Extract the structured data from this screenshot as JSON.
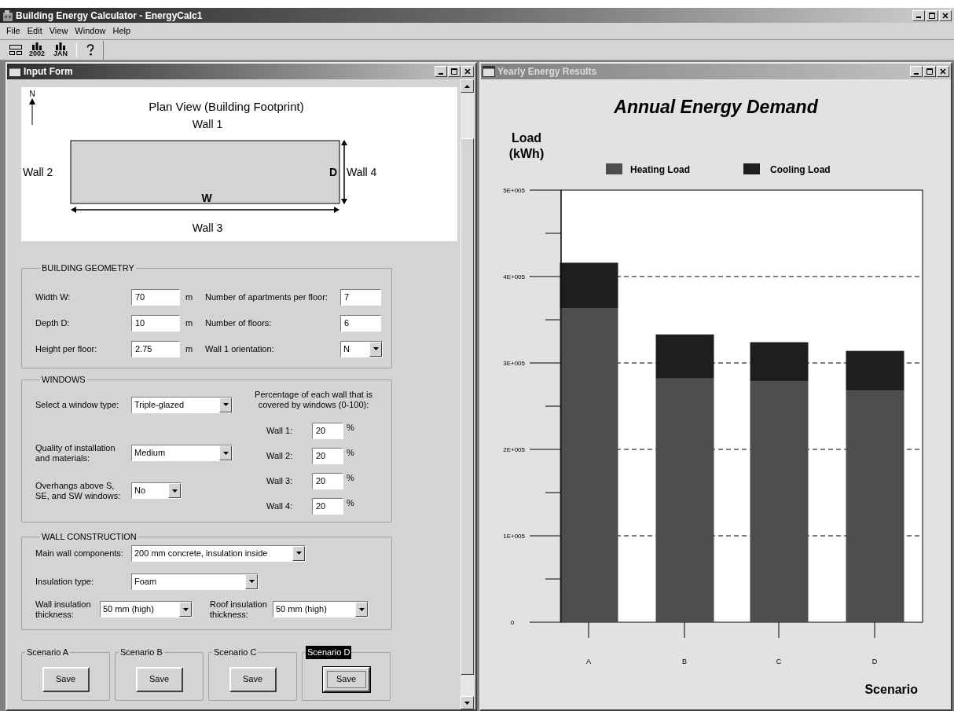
{
  "app": {
    "title": "Building Energy Calculator - EnergyCalc1"
  },
  "menu": [
    "File",
    "Edit",
    "View",
    "Window",
    "Help"
  ],
  "toolbar": {
    "year": "2002",
    "month": "JAN"
  },
  "input_form": {
    "title": "Input Form",
    "active": true,
    "plan_view": {
      "title": "Plan View (Building Footprint)",
      "north": "N",
      "walls": [
        "Wall 1",
        "Wall 2",
        "Wall 3",
        "Wall 4"
      ],
      "width_label": "W",
      "depth_label": "D"
    },
    "geometry": {
      "heading": "BUILDING GEOMETRY",
      "fields": [
        {
          "label": "Width W:",
          "value": "70",
          "unit": "m"
        },
        {
          "label": "Depth D:",
          "value": "10",
          "unit": "m"
        },
        {
          "label": "Height per floor:",
          "value": "2.75",
          "unit": "m"
        }
      ],
      "fields_right": [
        {
          "label": "Number of apartments per floor:",
          "value": "7",
          "kind": "text"
        },
        {
          "label": "Number of floors:",
          "value": "6",
          "kind": "text"
        },
        {
          "label": "Wall 1 orientation:",
          "value": "N",
          "kind": "dropdown"
        }
      ]
    },
    "windows": {
      "heading": "WINDOWS",
      "options": [
        {
          "label": "Select a window type:",
          "value": "Triple-glazed"
        },
        {
          "label": "Quality of installation and materials:",
          "value": "Medium"
        },
        {
          "label": "Overhangs above S, SE, and SW windows:",
          "value": "No"
        }
      ],
      "percent_heading": "Percentage of each wall that is covered by windows (0-100):",
      "walls": [
        {
          "label": "Wall 1:",
          "value": "20",
          "unit": "%"
        },
        {
          "label": "Wall 2:",
          "value": "20",
          "unit": "%"
        },
        {
          "label": "Wall 3:",
          "value": "20",
          "unit": "%"
        },
        {
          "label": "Wall 4:",
          "value": "20",
          "unit": "%"
        }
      ]
    },
    "wall_construction": {
      "heading": "WALL CONSTRUCTION",
      "main_components": {
        "label": "Main wall components:",
        "value": "200 mm concrete, insulation inside"
      },
      "insulation_type": {
        "label": "Insulation type:",
        "value": "Foam"
      },
      "wall_thickness": {
        "label": "Wall insulation thickness:",
        "value": "50 mm (high)"
      },
      "roof_thickness": {
        "label": "Roof insulation thickness:",
        "value": "50 mm (high)"
      }
    },
    "scenarios": [
      {
        "label": "Scenario A",
        "button": "Save",
        "selected": false
      },
      {
        "label": "Scenario B",
        "button": "Save",
        "selected": false
      },
      {
        "label": "Scenario C",
        "button": "Save",
        "selected": false
      },
      {
        "label": "Scenario D",
        "button": "Save",
        "selected": true
      }
    ]
  },
  "results": {
    "title": "Yearly Energy Results",
    "active": false,
    "chart_data": {
      "type": "bar",
      "stacked": true,
      "title": "Annual Energy Demand",
      "ylabel": "Load (kWh)",
      "xlabel": "Scenario",
      "categories": [
        "A",
        "B",
        "C",
        "D"
      ],
      "series": [
        {
          "name": "Heating Load",
          "color": "#4d4d4d",
          "values": [
            363000,
            282000,
            279000,
            268000
          ]
        },
        {
          "name": "Cooling Load",
          "color": "#1e1e1e",
          "values": [
            53000,
            51000,
            45000,
            46000
          ]
        }
      ],
      "ylim": [
        0,
        500000
      ],
      "grid": true,
      "legend": true,
      "yticks": [
        {
          "value": 0,
          "label": "0"
        },
        {
          "value": 100000,
          "label": "1E+005"
        },
        {
          "value": 200000,
          "label": "2E+005"
        },
        {
          "value": 300000,
          "label": "3E+005"
        },
        {
          "value": 400000,
          "label": "4E+005"
        },
        {
          "value": 500000,
          "label": "5E+005"
        }
      ]
    }
  }
}
